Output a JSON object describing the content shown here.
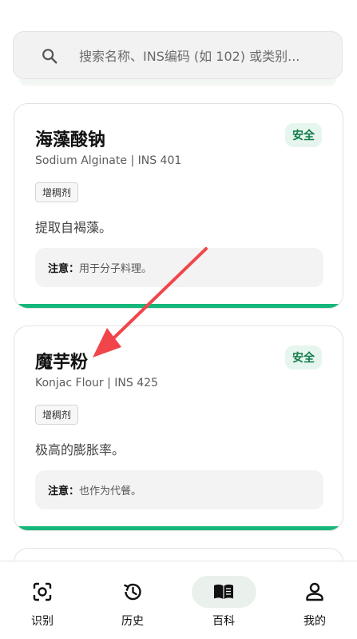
{
  "search": {
    "placeholder": "搜索名称、INS编码 (如 102) 或类别..."
  },
  "cards": [
    {
      "name": "海藻酸钠",
      "subtitle": "Sodium Alginate | INS 401",
      "badge": "安全",
      "tag": "增稠剂",
      "description": "提取自褐藻。",
      "note_label": "注意：",
      "note_text": "用于分子料理。"
    },
    {
      "name": "魔芋粉",
      "subtitle": "Konjac Flour | INS 425",
      "badge": "安全",
      "tag": "增稠剂",
      "description": "极高的膨胀率。",
      "note_label": "注意：",
      "note_text": "也作为代餐。"
    }
  ],
  "nav": {
    "items": [
      {
        "label": "识别",
        "icon": "scan-icon"
      },
      {
        "label": "历史",
        "icon": "history-icon"
      },
      {
        "label": "百科",
        "icon": "book-icon",
        "active": true
      },
      {
        "label": "我的",
        "icon": "person-icon"
      }
    ]
  },
  "colors": {
    "accent": "#16b77a",
    "badge_bg": "#e6f6ee",
    "badge_text": "#127a4a",
    "annotation_arrow": "#f0464b"
  }
}
